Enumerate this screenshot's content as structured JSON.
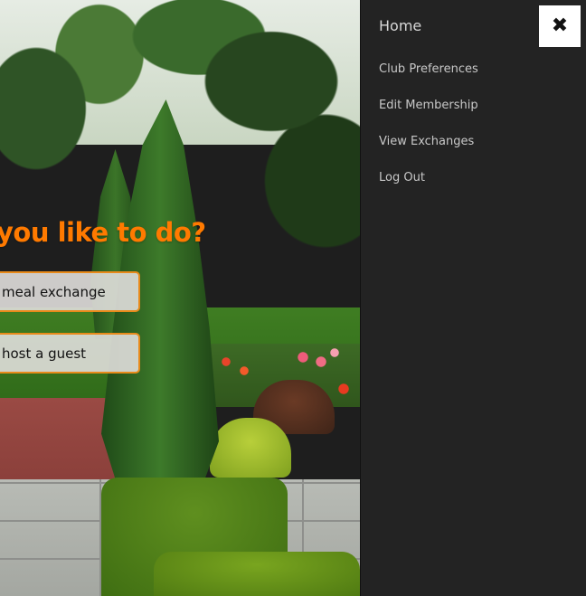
{
  "main": {
    "question": "you like to do?",
    "actions": [
      {
        "label": "meal exchange"
      },
      {
        "label": "host a guest"
      }
    ]
  },
  "menu": {
    "items": [
      {
        "label": "Home"
      },
      {
        "label": "Club Preferences"
      },
      {
        "label": "Edit Membership"
      },
      {
        "label": "View Exchanges"
      },
      {
        "label": "Log Out"
      }
    ],
    "close_icon_glyph": "✖"
  },
  "colors": {
    "accent_orange": "#ff7a00",
    "button_border": "#e88a1a",
    "menu_bg": "#232323",
    "menu_text": "#c8c8c8"
  },
  "icons": {
    "close": "close-icon"
  }
}
